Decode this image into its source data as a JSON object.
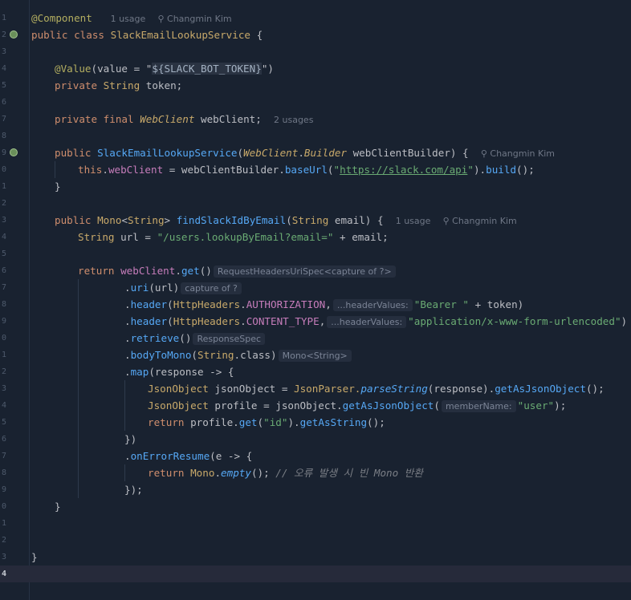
{
  "gutter": {
    "line_numbers": [
      "1",
      "2",
      "3",
      "4",
      "5",
      "6",
      "7",
      "8",
      "9",
      "0",
      "1",
      "2",
      "3",
      "4",
      "5",
      "6",
      "7",
      "8",
      "9",
      "0",
      "1",
      "2",
      "3",
      "4",
      "5",
      "6",
      "7",
      "8",
      "9",
      "0",
      "1",
      "2",
      "3",
      "4"
    ],
    "current_line_index": 33
  },
  "meta": {
    "usage_1": "1 usage",
    "usage_2": "2 usages",
    "author": "Changmin Kim"
  },
  "code": {
    "annotation_component": "@Component",
    "public": "public",
    "class": "class",
    "private": "private",
    "final": "final",
    "return": "return",
    "this": "this",
    "class_name": "SlackEmailLookupService",
    "open_brace": " {",
    "value_annotation": "@Value",
    "value_open": "(value = \"",
    "token_placeholder": "${SLACK_BOT_TOKEN}",
    "value_close": "\")",
    "string_type": "String",
    "token_decl": " token;",
    "webclient_type": "WebClient",
    "webclient_decl": " webClient;",
    "builder_type": "Builder",
    "ctor_params": " webClientBuilder) {",
    "ctor_this_field": "webClient",
    "ctor_assign": " = webClientBuilder.",
    "baseurl_fn": "baseUrl",
    "slack_url": "https://slack.com/api",
    "build_fn": "build",
    "ctor_end": "();",
    "close_brace": "}",
    "mono": "Mono",
    "find_fn": "findSlackIdByEmail",
    "find_params": " email) {",
    "url_decl": " url = ",
    "url_string": "\"/users.lookupByEmail?email=\"",
    "url_concat": " + email;",
    "get_fn": "get",
    "hint_request": "RequestHeadersUriSpec<capture of ?>",
    "uri_fn": "uri",
    "uri_arg": "(url)",
    "hint_capture": "capture of ?",
    "header_fn": "header",
    "http_headers": "HttpHeaders",
    "authorization": "AUTHORIZATION",
    "hint_header_values": "...headerValues:",
    "bearer": "\"Bearer \"",
    "bearer_rest": " + token)",
    "content_type": "CONTENT_TYPE",
    "form_encoded": "\"application/x-www-form-urlencoded\"",
    "retrieve_fn": "retrieve",
    "hint_response": "ResponseSpec",
    "bodytomono_fn": "bodyToMono",
    "string_class": ".class)",
    "hint_mono": "Mono<String>",
    "map_fn": "map",
    "map_arg": "(response -> {",
    "json_object": "JsonObject",
    "json_var": " jsonObject = ",
    "json_parser": "JsonParser.",
    "parse_fn": "parseString",
    "parse_arg": "(response).",
    "get_as_obj_fn": "getAsJsonObject",
    "call_end": "();",
    "profile_decl": " profile = jsonObject.",
    "hint_member": "memberName:",
    "user_str": "\"user\"",
    "close_call": ");",
    "profile_get": "profile.",
    "id_str": "\"id\"",
    "get_as_string_fn": "getAsString",
    "close_paren": "})",
    "on_error_fn": "onErrorResume",
    "on_error_arg": "(e -> {",
    "empty_fn": "empty",
    "comment": "// 오류 발생 시 빈 Mono 반환",
    "close_final": "});",
    "dot": ".",
    "paren_open": "(",
    "paren_close": ")",
    "comma": ",",
    "semicolon": ";"
  }
}
